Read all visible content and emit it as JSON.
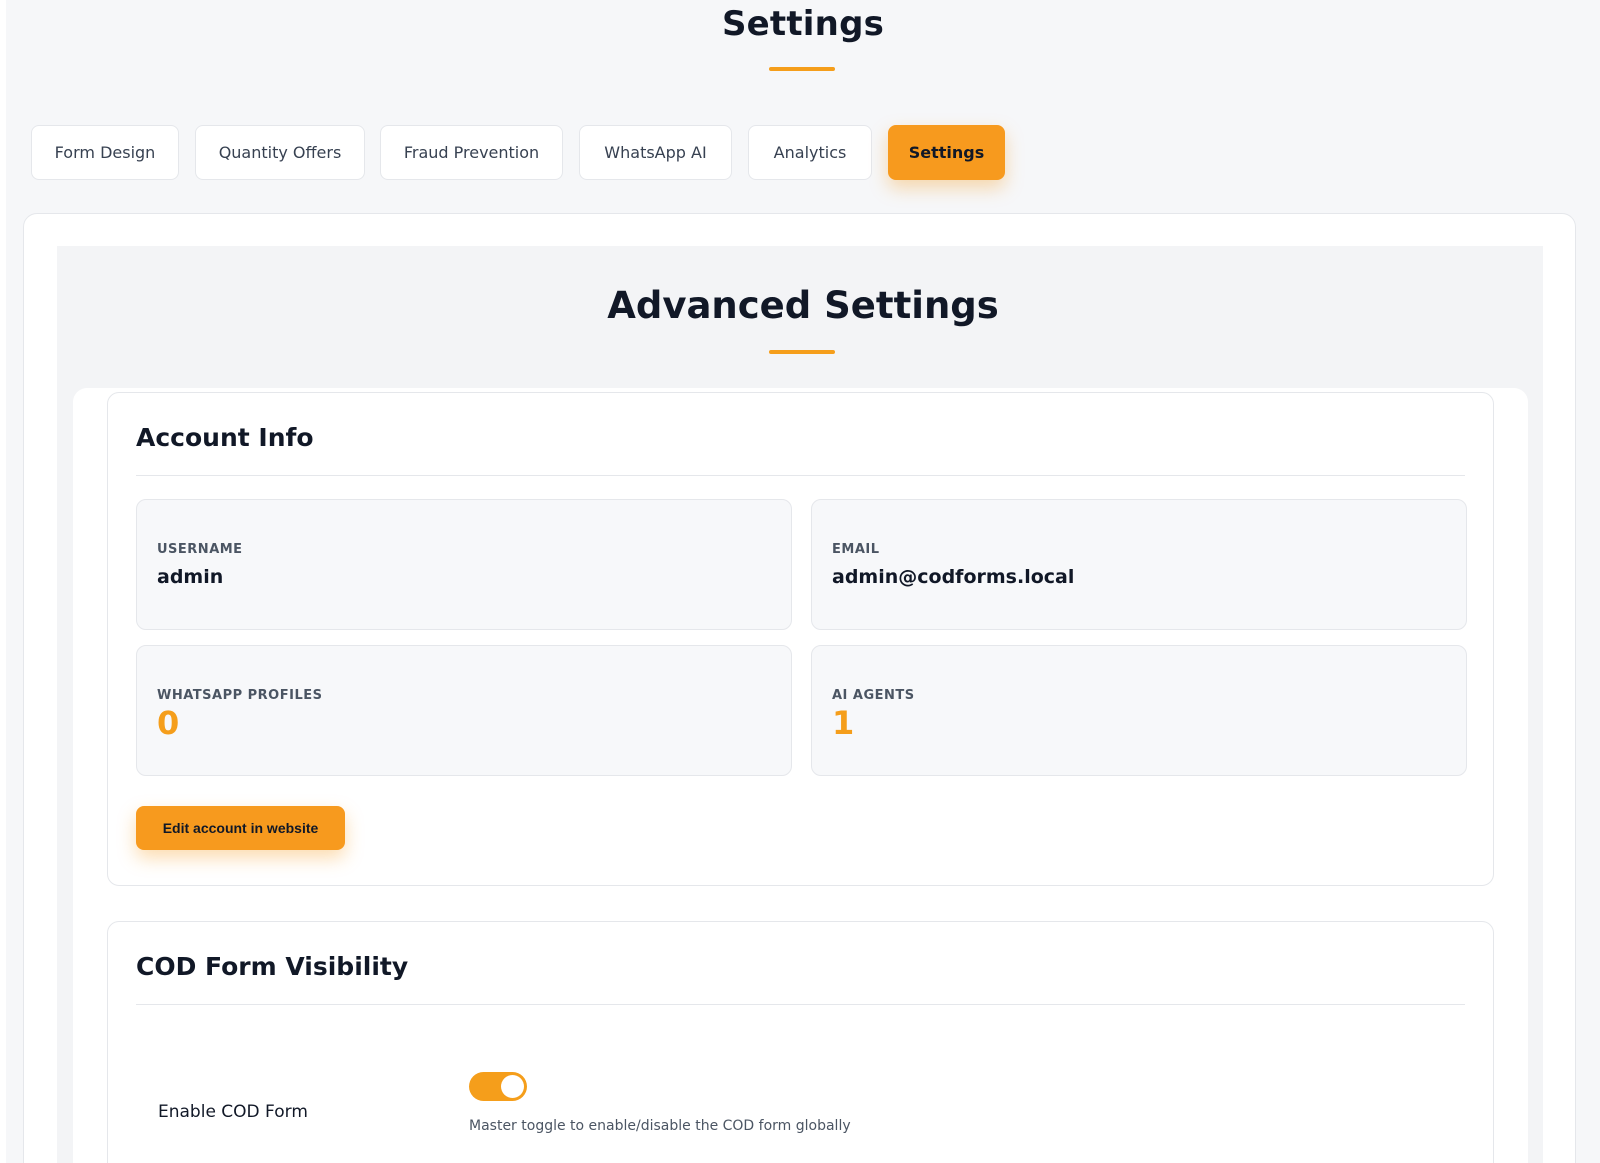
{
  "page": {
    "title": "Settings"
  },
  "tabs": [
    {
      "label": "Form Design",
      "active": false
    },
    {
      "label": "Quantity Offers",
      "active": false
    },
    {
      "label": "Fraud Prevention",
      "active": false
    },
    {
      "label": "WhatsApp AI",
      "active": false
    },
    {
      "label": "Analytics",
      "active": false
    },
    {
      "label": "Settings",
      "active": true
    }
  ],
  "advanced": {
    "title": "Advanced Settings"
  },
  "account_info": {
    "title": "Account Info",
    "username_label": "USERNAME",
    "username_value": "admin",
    "email_label": "EMAIL",
    "email_value": "admin@codforms.local",
    "whatsapp_profiles_label": "WHATSAPP PROFILES",
    "whatsapp_profiles_value": "0",
    "ai_agents_label": "AI AGENTS",
    "ai_agents_value": "1",
    "edit_button_label": "Edit account in website"
  },
  "cod_visibility": {
    "title": "COD Form Visibility",
    "enable_label": "Enable COD Form",
    "enable_on": true,
    "enable_help": "Master toggle to enable/disable the COD form globally"
  },
  "colors": {
    "accent": "#f79a1e",
    "accent_dark": "#f59e1b",
    "background": "#f6f7f9"
  }
}
